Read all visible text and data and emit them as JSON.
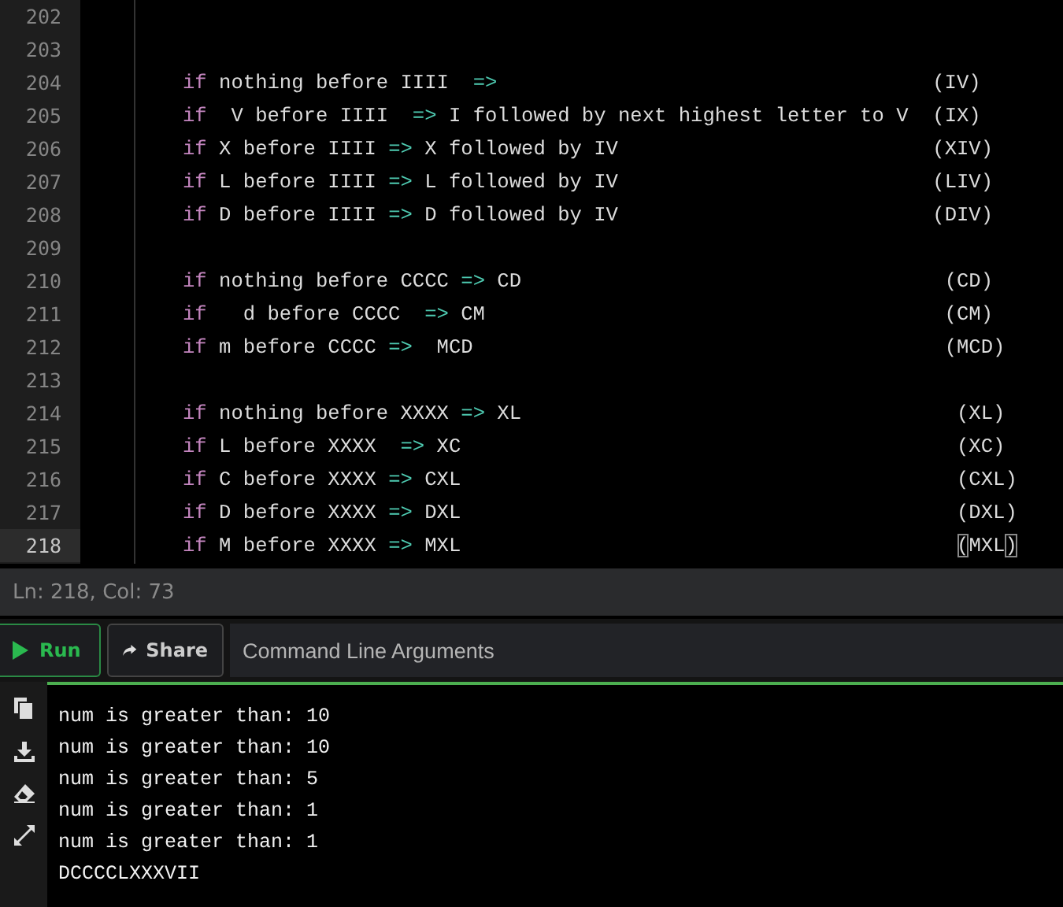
{
  "editor": {
    "lines": [
      {
        "number": "202",
        "current": false
      },
      {
        "number": "203",
        "current": false
      },
      {
        "number": "204",
        "current": false,
        "tokens": [
          {
            "kind": "keyword",
            "text": "if"
          },
          {
            "kind": "plain",
            "text": " nothing before IIII  "
          },
          {
            "kind": "operator",
            "text": "=>"
          },
          {
            "kind": "plain",
            "text": "                                    (IV)"
          }
        ]
      },
      {
        "number": "205",
        "current": false,
        "tokens": [
          {
            "kind": "keyword",
            "text": "if"
          },
          {
            "kind": "plain",
            "text": "  V before IIII  "
          },
          {
            "kind": "operator",
            "text": "=>"
          },
          {
            "kind": "plain",
            "text": " I followed by next highest letter to V  (IX)"
          }
        ]
      },
      {
        "number": "206",
        "current": false,
        "tokens": [
          {
            "kind": "keyword",
            "text": "if"
          },
          {
            "kind": "plain",
            "text": " X before IIII "
          },
          {
            "kind": "operator",
            "text": "=>"
          },
          {
            "kind": "plain",
            "text": " X followed by IV                          (XIV)"
          }
        ]
      },
      {
        "number": "207",
        "current": false,
        "tokens": [
          {
            "kind": "keyword",
            "text": "if"
          },
          {
            "kind": "plain",
            "text": " L before IIII "
          },
          {
            "kind": "operator",
            "text": "=>"
          },
          {
            "kind": "plain",
            "text": " L followed by IV                          (LIV)"
          }
        ]
      },
      {
        "number": "208",
        "current": false,
        "tokens": [
          {
            "kind": "keyword",
            "text": "if"
          },
          {
            "kind": "plain",
            "text": " D before IIII "
          },
          {
            "kind": "operator",
            "text": "=>"
          },
          {
            "kind": "plain",
            "text": " D followed by IV                          (DIV)"
          }
        ]
      },
      {
        "number": "209",
        "current": false
      },
      {
        "number": "210",
        "current": false,
        "tokens": [
          {
            "kind": "keyword",
            "text": "if"
          },
          {
            "kind": "plain",
            "text": " nothing before CCCC "
          },
          {
            "kind": "operator",
            "text": "=>"
          },
          {
            "kind": "plain",
            "text": " CD                                   (CD)"
          }
        ]
      },
      {
        "number": "211",
        "current": false,
        "tokens": [
          {
            "kind": "keyword",
            "text": "if"
          },
          {
            "kind": "plain",
            "text": "   d before CCCC  "
          },
          {
            "kind": "operator",
            "text": "=>"
          },
          {
            "kind": "plain",
            "text": " CM                                      (CM)"
          }
        ]
      },
      {
        "number": "212",
        "current": false,
        "tokens": [
          {
            "kind": "keyword",
            "text": "if"
          },
          {
            "kind": "plain",
            "text": " m before CCCC "
          },
          {
            "kind": "operator",
            "text": "=>"
          },
          {
            "kind": "plain",
            "text": "  MCD                                       (MCD)"
          }
        ]
      },
      {
        "number": "213",
        "current": false
      },
      {
        "number": "214",
        "current": false,
        "tokens": [
          {
            "kind": "keyword",
            "text": "if"
          },
          {
            "kind": "plain",
            "text": " nothing before XXXX "
          },
          {
            "kind": "operator",
            "text": "=>"
          },
          {
            "kind": "plain",
            "text": " XL                                    (XL)"
          }
        ]
      },
      {
        "number": "215",
        "current": false,
        "tokens": [
          {
            "kind": "keyword",
            "text": "if"
          },
          {
            "kind": "plain",
            "text": " L before XXXX  "
          },
          {
            "kind": "operator",
            "text": "=>"
          },
          {
            "kind": "plain",
            "text": " XC                                         (XC)"
          }
        ]
      },
      {
        "number": "216",
        "current": false,
        "tokens": [
          {
            "kind": "keyword",
            "text": "if"
          },
          {
            "kind": "plain",
            "text": " C before XXXX "
          },
          {
            "kind": "operator",
            "text": "=>"
          },
          {
            "kind": "plain",
            "text": " CXL                                         (CXL)"
          }
        ]
      },
      {
        "number": "217",
        "current": false,
        "tokens": [
          {
            "kind": "keyword",
            "text": "if"
          },
          {
            "kind": "plain",
            "text": " D before XXXX "
          },
          {
            "kind": "operator",
            "text": "=>"
          },
          {
            "kind": "plain",
            "text": " DXL                                         (DXL)"
          }
        ]
      },
      {
        "number": "218",
        "current": true,
        "tokens": [
          {
            "kind": "keyword",
            "text": "if"
          },
          {
            "kind": "plain",
            "text": " M before XXXX "
          },
          {
            "kind": "operator",
            "text": "=>"
          },
          {
            "kind": "plain",
            "text": " MXL                                         "
          },
          {
            "kind": "bracket",
            "text": "("
          },
          {
            "kind": "plain",
            "text": "MXL"
          },
          {
            "kind": "bracket",
            "text": ")"
          }
        ]
      }
    ]
  },
  "status_bar": {
    "position": "Ln: 218,  Col: 73"
  },
  "toolbar": {
    "run": "Run",
    "share": "Share",
    "arguments": {
      "placeholder": "Command Line Arguments"
    }
  },
  "output": {
    "lines": [
      "num is greater than: 10",
      "num is greater than: 10",
      "num is greater than: 5",
      "num is greater than: 1",
      "num is greater than: 1",
      "DCCCCLXXXVII"
    ]
  }
}
